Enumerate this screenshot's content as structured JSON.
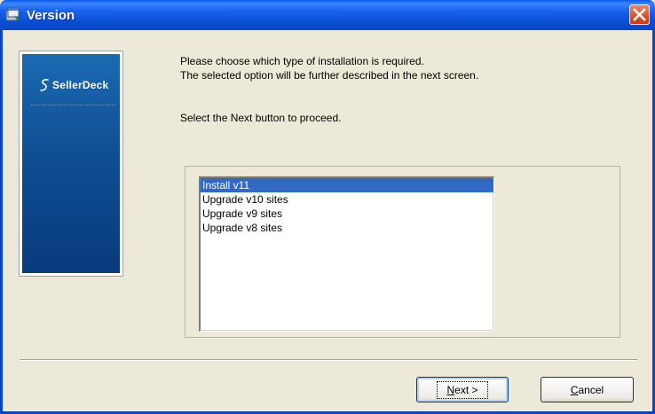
{
  "window": {
    "title": "Version",
    "close_label": "Close"
  },
  "side_panel": {
    "logo_text": "SellerDeck",
    "logo_icon": "s-swirl-icon",
    "bg_color": "#0f4f94"
  },
  "instructions": {
    "line1": "Please choose which type of installation is required.",
    "line2": "The selected option will be further described in the next screen.",
    "line3": "Select the Next button to proceed."
  },
  "listbox": {
    "items": [
      {
        "label": "Install v11",
        "selected": true
      },
      {
        "label": "Upgrade v10 sites",
        "selected": false
      },
      {
        "label": "Upgrade v9 sites",
        "selected": false
      },
      {
        "label": "Upgrade v8 sites",
        "selected": false
      }
    ],
    "selection_color": "#316ac5"
  },
  "buttons": {
    "next": {
      "mnemonic": "N",
      "rest": "ext >"
    },
    "cancel": {
      "mnemonic": "C",
      "rest": "ancel"
    }
  },
  "colors": {
    "titlebar": "#0a4fd6",
    "dialog_bg": "#ece9d8",
    "close_button": "#d9522c"
  }
}
